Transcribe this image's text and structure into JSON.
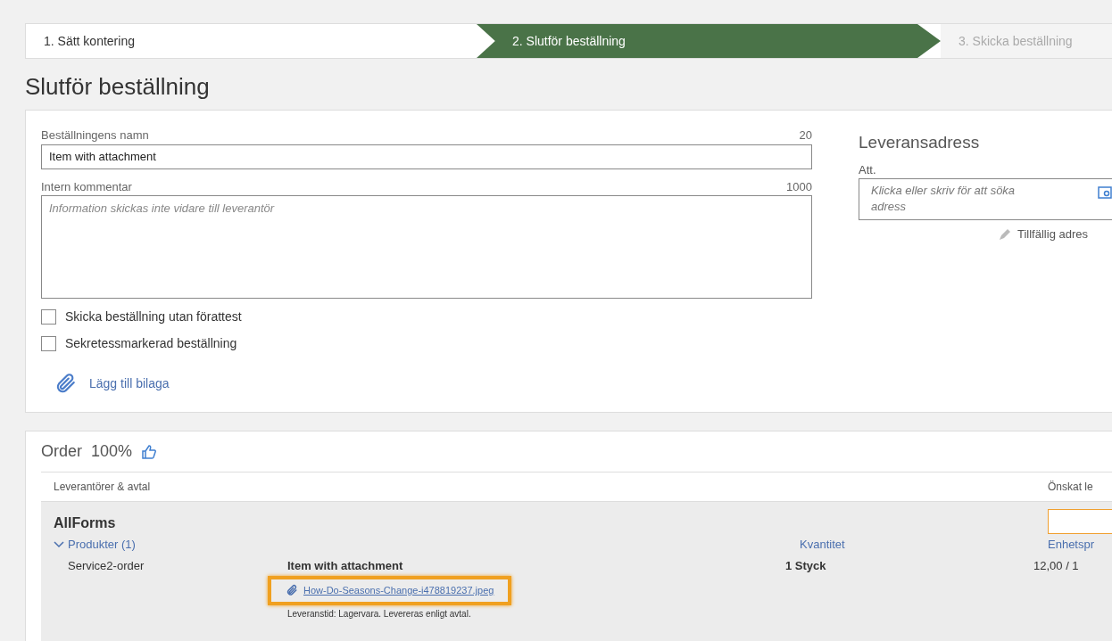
{
  "steps": [
    {
      "label": "1. Sätt kontering",
      "selected": false,
      "disabled": false
    },
    {
      "label": "2. Slutför beställning",
      "selected": true,
      "disabled": false
    },
    {
      "label": "3. Skicka beställning",
      "selected": false,
      "disabled": true
    }
  ],
  "title": "Slutför beställning",
  "form": {
    "name_label": "Beställningens namn",
    "name_limit": "20",
    "name_value": "Item with attachment",
    "comment_label": "Intern kommentar",
    "comment_limit": "1000",
    "comment_placeholder": "Information skickas inte vidare till leverantör",
    "checkboxes": [
      {
        "label": "Skicka beställning utan förattest",
        "checked": false
      },
      {
        "label": "Sekretessmarkerad beställning",
        "checked": false
      }
    ],
    "attach_link": "Lägg till bilaga"
  },
  "delivery": {
    "heading": "Leveransadress",
    "att_label": "Att.",
    "address_placeholder": "Klicka eller skriv för att söka adress",
    "temp_link": "Tillfällig adres"
  },
  "order": {
    "title": "Order",
    "percent": "100%",
    "col_suppliers": "Leverantörer & avtal",
    "col_date": "Önskat le",
    "supplier": "AllForms",
    "products_toggle": "Produkter (1)",
    "expanded": true,
    "col_quantity": "Kvantitet",
    "col_price": "Enhetspr",
    "product": {
      "code": "Service2-order",
      "name": "Item with attachment",
      "attachment": "How-Do-Seasons-Change-i478819237.jpeg",
      "attachment_highlighted": true,
      "delivery_note": "Leveranstid: Lagervara. Levereras enligt avtal.",
      "quantity": "1 Styck",
      "price": "12,00 / 1"
    }
  }
}
